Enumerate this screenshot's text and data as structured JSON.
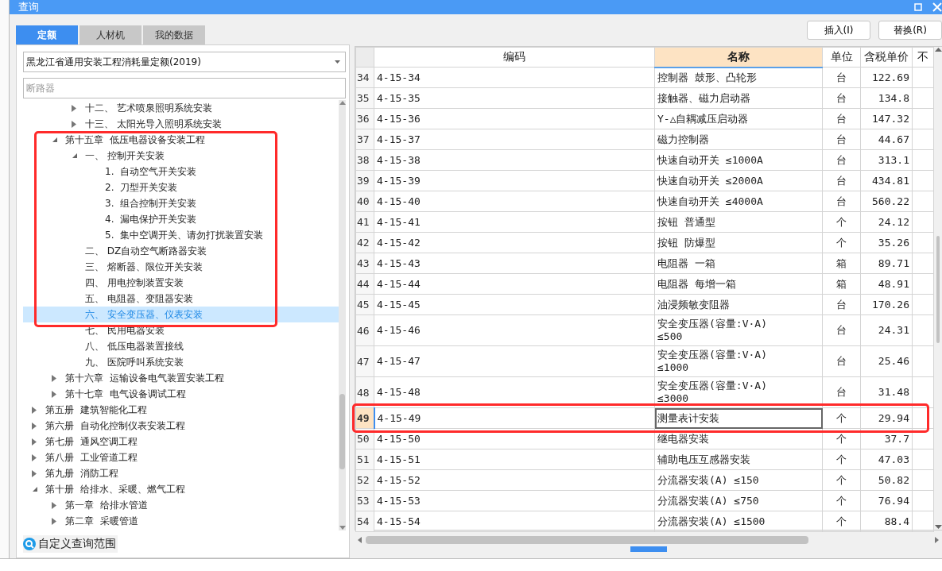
{
  "window": {
    "title": "查询"
  },
  "tabs": [
    {
      "label": "定额",
      "selected": true
    },
    {
      "label": "人材机",
      "selected": false
    },
    {
      "label": "我的数据",
      "selected": false
    }
  ],
  "toolbar": {
    "buttons": [
      "插入(I)",
      "替换(R)"
    ]
  },
  "library_select": {
    "value": "黑龙江省通用安装工程消耗量定额(2019)"
  },
  "search": {
    "placeholder": "断路器"
  },
  "tree": [
    {
      "children": [
        {
          "children": [
            {
              "label": "十二、 艺术喷泉照明系统安装",
              "expanded": false,
              "selected": false
            },
            {
              "label": "十三、 太阳光导入照明系统安装",
              "expanded": false,
              "selected": false
            }
          ]
        },
        {
          "label": "第十五章  低压电器设备安装工程",
          "expanded": true,
          "selected": false,
          "children": [
            {
              "label": "一、 控制开关安装",
              "expanded": true,
              "selected": false,
              "children": [
                {
                  "label": "1.  自动空气开关安装",
                  "selected": false
                },
                {
                  "label": "2.  刀型开关安装",
                  "selected": false
                },
                {
                  "label": "3.  组合控制开关安装",
                  "selected": false
                },
                {
                  "label": "4.  漏电保护开关安装",
                  "selected": false
                },
                {
                  "label": "5.  集中空调开关、请勿打扰装置安装",
                  "selected": false
                }
              ]
            },
            {
              "label": "二、 DZ自动空气断路器安装",
              "selected": false
            },
            {
              "label": "三、 熔断器、限位开关安装",
              "selected": false
            },
            {
              "label": "四、 用电控制装置安装",
              "selected": false
            },
            {
              "label": "五、 电阻器、变阻器安装",
              "selected": false
            },
            {
              "label": "六、 安全变压器、仪表安装",
              "selected": true
            },
            {
              "label": "七、 民用电器安装",
              "selected": false
            },
            {
              "label": "八、 低压电器装置接线",
              "selected": false
            },
            {
              "label": "九、 医院呼叫系统安装",
              "selected": false
            }
          ]
        },
        {
          "label": "第十六章  运输设备电气装置安装工程",
          "expanded": false,
          "selected": false
        },
        {
          "label": "第十七章  电气设备调试工程",
          "expanded": false,
          "selected": false
        }
      ]
    },
    {
      "label": "第五册  建筑智能化工程",
      "expanded": false,
      "selected": false
    },
    {
      "label": "第六册  自动化控制仪表安装工程",
      "expanded": false,
      "selected": false
    },
    {
      "label": "第七册  通风空调工程",
      "expanded": false,
      "selected": false
    },
    {
      "label": "第八册  工业管道工程",
      "expanded": false,
      "selected": false
    },
    {
      "label": "第九册  消防工程",
      "expanded": false,
      "selected": false
    },
    {
      "label": "第十册  给排水、采暖、燃气工程",
      "expanded": true,
      "selected": false,
      "children": [
        {
          "label": "第一章  给排水管道",
          "expanded": false,
          "selected": false
        },
        {
          "label": "第二章  采暖管道",
          "expanded": false,
          "selected": false
        }
      ]
    }
  ],
  "custom_scope_link": "自定义查询范围",
  "table": {
    "columns": [
      {
        "label": "编码",
        "selected": false
      },
      {
        "label": "名称",
        "selected": true
      },
      {
        "label": "单位",
        "selected": false
      },
      {
        "label": "含税单价",
        "selected": false
      },
      {
        "label": "不",
        "selected": false
      }
    ],
    "rows": [
      {
        "number": "34",
        "code": "4-15-34",
        "name": "控制器 鼓形、凸轮形",
        "unit": "台",
        "price": "122.69",
        "selected": false
      },
      {
        "number": "35",
        "code": "4-15-35",
        "name": "接触器、磁力启动器",
        "unit": "台",
        "price": "134.8",
        "selected": false
      },
      {
        "number": "36",
        "code": "4-15-36",
        "name": "Y-△自耦减压启动器",
        "unit": "台",
        "price": "147.32",
        "selected": false
      },
      {
        "number": "37",
        "code": "4-15-37",
        "name": "磁力控制器",
        "unit": "台",
        "price": "44.67",
        "selected": false
      },
      {
        "number": "38",
        "code": "4-15-38",
        "name": "快速自动开关 ≤1000A",
        "unit": "台",
        "price": "313.1",
        "selected": false
      },
      {
        "number": "39",
        "code": "4-15-39",
        "name": "快速自动开关 ≤2000A",
        "unit": "台",
        "price": "434.81",
        "selected": false
      },
      {
        "number": "40",
        "code": "4-15-40",
        "name": "快速自动开关 ≤4000A",
        "unit": "台",
        "price": "560.22",
        "selected": false
      },
      {
        "number": "41",
        "code": "4-15-41",
        "name": "按钮 普通型",
        "unit": "个",
        "price": "24.12",
        "selected": false
      },
      {
        "number": "42",
        "code": "4-15-42",
        "name": "按钮 防爆型",
        "unit": "个",
        "price": "35.26",
        "selected": false
      },
      {
        "number": "43",
        "code": "4-15-43",
        "name": "电阻器 一箱",
        "unit": "箱",
        "price": "89.71",
        "selected": false
      },
      {
        "number": "44",
        "code": "4-15-44",
        "name": "电阻器 每增一箱",
        "unit": "箱",
        "price": "48.91",
        "selected": false
      },
      {
        "number": "45",
        "code": "4-15-45",
        "name": "油浸频敏变阻器",
        "unit": "台",
        "price": "170.26",
        "selected": false
      },
      {
        "number": "46",
        "code": "4-15-46",
        "name": "安全变压器(容量:V·A)\n≤500",
        "unit": "台",
        "price": "24.31",
        "selected": false
      },
      {
        "number": "47",
        "code": "4-15-47",
        "name": "安全变压器(容量:V·A)\n≤1000",
        "unit": "台",
        "price": "25.46",
        "selected": false
      },
      {
        "number": "48",
        "code": "4-15-48",
        "name": "安全变压器(容量:V·A)\n≤3000",
        "unit": "台",
        "price": "31.48",
        "selected": false
      },
      {
        "number": "49",
        "code": "4-15-49",
        "name": "测量表计安装",
        "unit": "个",
        "price": "29.94",
        "selected": true
      },
      {
        "number": "50",
        "code": "4-15-50",
        "name": "继电器安装",
        "unit": "个",
        "price": "37.7",
        "selected": false
      },
      {
        "number": "51",
        "code": "4-15-51",
        "name": "辅助电压互感器安装",
        "unit": "个",
        "price": "47.03",
        "selected": false
      },
      {
        "number": "52",
        "code": "4-15-52",
        "name": "分流器安装(A) ≤150",
        "unit": "个",
        "price": "50.82",
        "selected": false
      },
      {
        "number": "53",
        "code": "4-15-53",
        "name": "分流器安装(A) ≤750",
        "unit": "个",
        "price": "76.94",
        "selected": false
      },
      {
        "number": "54",
        "code": "4-15-54",
        "name": "分流器安装(A) ≤1500",
        "unit": "个",
        "price": "88.4",
        "selected": false
      }
    ]
  }
}
